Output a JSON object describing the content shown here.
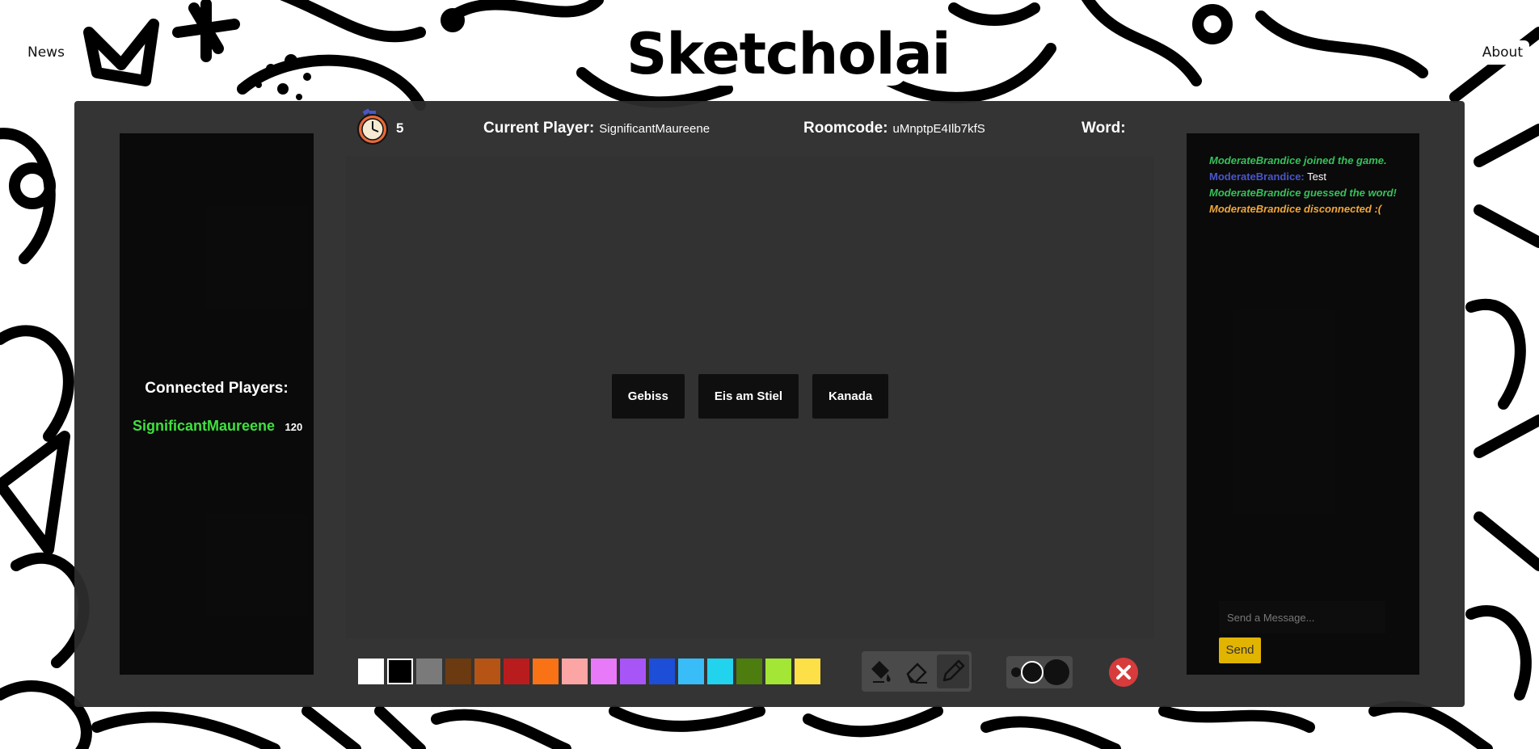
{
  "header": {
    "news_label": "News",
    "about_label": "About",
    "logo_text": "Sketcholai"
  },
  "game": {
    "timer_value": "5",
    "current_player_label": "Current Player:",
    "current_player_value": "SignificantMaureene",
    "roomcode_label": "Roomcode:",
    "roomcode_value": "uMnptpE4Ilb7kfS",
    "word_label": "Word:",
    "word_value": ""
  },
  "players": {
    "title": "Connected Players:",
    "list": [
      {
        "name": "SignificantMaureene",
        "score": "120"
      }
    ]
  },
  "word_choices": [
    "Gebiss",
    "Eis am Stiel",
    "Kanada"
  ],
  "chat": {
    "messages": [
      {
        "type": "system",
        "text": "ModerateBrandice joined the game."
      },
      {
        "type": "message",
        "name": "ModerateBrandice:",
        "text": "Test"
      },
      {
        "type": "system",
        "text": "ModerateBrandice guessed the word!"
      },
      {
        "type": "warning",
        "text": "ModerateBrandice disconnected :("
      }
    ],
    "input_placeholder": "Send a Message...",
    "send_label": "Send"
  },
  "palette": {
    "selected_index": 1,
    "colors": [
      "#ffffff",
      "#000000",
      "#7a7a7a",
      "#6b3a10",
      "#b55414",
      "#b91c1c",
      "#f97316",
      "#fca5a5",
      "#e879f9",
      "#a855f7",
      "#1d4ed8",
      "#38bdf8",
      "#22d3ee",
      "#4d7c0f",
      "#a3e635",
      "#fde047"
    ]
  },
  "tools": [
    {
      "name": "fill-bucket-icon",
      "active": false
    },
    {
      "name": "eraser-icon",
      "active": false
    },
    {
      "name": "pencil-icon",
      "active": true
    }
  ],
  "brush_sizes": [
    "small",
    "medium",
    "large"
  ],
  "colors": {
    "panel": "#2c2c2c",
    "canvas": "#323232",
    "player_name": "#3ee13e",
    "chat_system": "#35c25a",
    "chat_name": "#4a55c9",
    "chat_warning": "#f0a73a",
    "send_button": "#e1b400",
    "clear_button": "#d73b3b"
  }
}
